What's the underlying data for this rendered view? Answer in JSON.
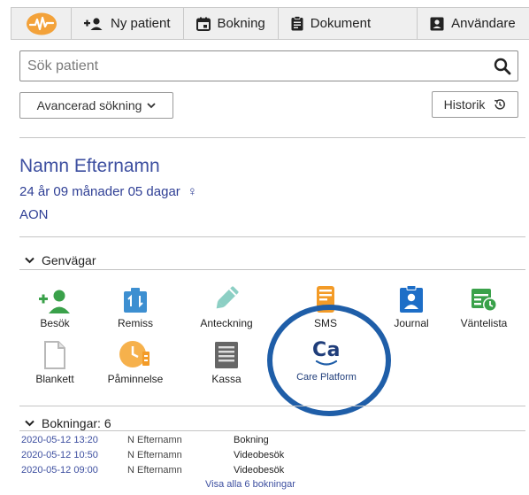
{
  "toolbar": {
    "new_patient": "Ny patient",
    "booking": "Bokning",
    "document": "Dokument",
    "user": "Användare"
  },
  "search": {
    "placeholder": "Sök patient"
  },
  "advanced_search": "Avancerad sökning",
  "history": "Historik",
  "patient": {
    "name": "Namn Efternamn",
    "age": "24 år 09 månader 05 dagar",
    "gender_symbol": "♀",
    "id": "AON"
  },
  "shortcuts": {
    "title": "Genvägar",
    "items": [
      {
        "label": "Besök"
      },
      {
        "label": "Remiss"
      },
      {
        "label": "Anteckning"
      },
      {
        "label": "SMS"
      },
      {
        "label": "Journal"
      },
      {
        "label": "Väntelista"
      },
      {
        "label": "Blankett"
      },
      {
        "label": "Påminnelse"
      },
      {
        "label": "Kassa"
      }
    ]
  },
  "care_platform": {
    "logo_text": "Ca",
    "label": "Care Platform"
  },
  "bookings": {
    "title": "Bokningar: 6",
    "rows": [
      {
        "date": "2020-05-12 13:20",
        "name": "N Efternamn",
        "type": "Bokning"
      },
      {
        "date": "2020-05-12 10:50",
        "name": "N Efternamn",
        "type": "Videobesök"
      },
      {
        "date": "2020-05-12 09:00",
        "name": "N Efternamn",
        "type": "Videobesök"
      }
    ],
    "show_all": "Visa alla 6 bokningar"
  },
  "colors": {
    "accent": "#f3a23a",
    "link": "#3d4fa0",
    "care_ring": "#1f5ea8",
    "green": "#3aa14a",
    "blue": "#3d8fd1",
    "orange": "#f39b27"
  }
}
